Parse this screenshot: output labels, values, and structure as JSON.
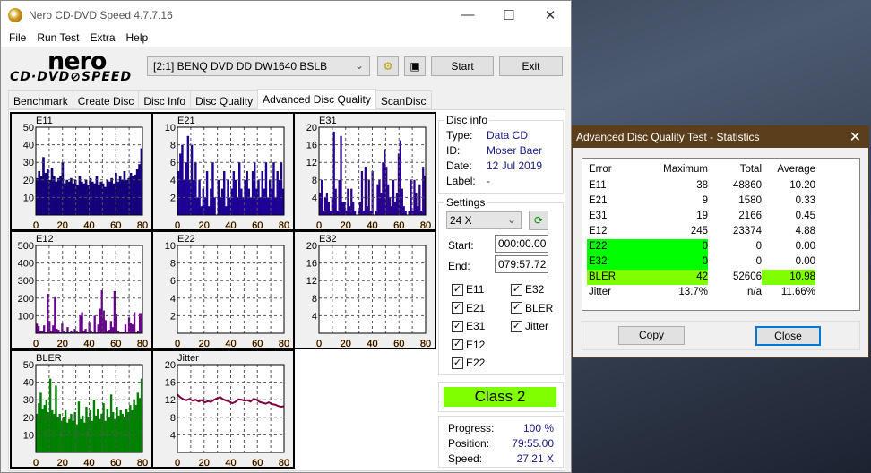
{
  "window": {
    "title": "Nero CD-DVD Speed 4.7.7.16",
    "minimize": "—",
    "maximize": "☐",
    "close": "✕"
  },
  "menu": [
    "File",
    "Run Test",
    "Extra",
    "Help"
  ],
  "logo": {
    "brand": "nero",
    "product": "CD·DVD⊘SPEED"
  },
  "toolbar": {
    "drive": "[2:1]   BENQ DVD DD DW1640 BSLB",
    "start": "Start",
    "exit": "Exit"
  },
  "tabs": [
    "Benchmark",
    "Create Disc",
    "Disc Info",
    "Disc Quality",
    "Advanced Disc Quality",
    "ScanDisc"
  ],
  "active_tab": "Advanced Disc Quality",
  "disc_info": {
    "heading": "Disc info",
    "rows": [
      {
        "k": "Type:",
        "v": "Data CD"
      },
      {
        "k": "ID:",
        "v": "Moser Baer"
      },
      {
        "k": "Date:",
        "v": "12 Jul 2019"
      },
      {
        "k": "Label:",
        "v": "-"
      }
    ]
  },
  "settings": {
    "heading": "Settings",
    "speed": "24 X",
    "start_label": "Start:",
    "start": "000:00.00",
    "end_label": "End:",
    "end": "079:57.72",
    "checks": [
      {
        "l": "E11",
        "c": true
      },
      {
        "l": "E21",
        "c": true
      },
      {
        "l": "E31",
        "c": true
      },
      {
        "l": "E12",
        "c": true
      },
      {
        "l": "E22",
        "c": true
      },
      {
        "l": "E32",
        "c": true
      },
      {
        "l": "BLER",
        "c": true
      },
      {
        "l": "Jitter",
        "c": true
      }
    ]
  },
  "class": "Class 2",
  "progress": {
    "rows": [
      {
        "k": "Progress:",
        "v": "100 %"
      },
      {
        "k": "Position:",
        "v": "79:55.00"
      },
      {
        "k": "Speed:",
        "v": "27.21 X"
      }
    ]
  },
  "chart_data": [
    {
      "name": "E11",
      "type": "bar",
      "color": "#14007a",
      "ylim": [
        0,
        50
      ],
      "yticks": [
        10,
        20,
        30,
        40,
        50
      ],
      "xlim": [
        0,
        80
      ],
      "xticks": [
        0,
        20,
        40,
        60,
        80
      ],
      "values": [
        21,
        25,
        22,
        33,
        24,
        26,
        20,
        27,
        22,
        19,
        21,
        22,
        30,
        18,
        20,
        19,
        21,
        18,
        20,
        17,
        22,
        19,
        18,
        20,
        17,
        21,
        19,
        18,
        22,
        17,
        19,
        18,
        16,
        20,
        19,
        21,
        18,
        24,
        19,
        22,
        20,
        25,
        20,
        21,
        24,
        22,
        23,
        26,
        29,
        38
      ]
    },
    {
      "name": "E21",
      "type": "bar",
      "color": "#1e0096",
      "ylim": [
        0,
        10
      ],
      "yticks": [
        2,
        4,
        6,
        8,
        10
      ],
      "xlim": [
        0,
        80
      ],
      "xticks": [
        0,
        20,
        40,
        60,
        80
      ],
      "values": [
        5,
        7,
        8,
        4,
        6,
        9,
        4,
        8,
        4,
        6,
        2,
        4,
        1,
        3,
        2,
        5,
        1,
        3,
        6,
        2,
        0,
        4,
        2,
        3,
        5,
        1,
        4,
        2,
        3,
        5,
        4,
        2,
        6,
        3,
        2,
        4,
        5,
        3,
        2,
        5,
        6,
        3,
        4,
        2,
        5,
        3,
        6,
        2,
        4,
        3,
        6,
        2,
        5,
        4,
        6,
        3
      ]
    },
    {
      "name": "E31",
      "type": "bar",
      "color": "#2a0090",
      "ylim": [
        0,
        20
      ],
      "yticks": [
        4,
        8,
        12,
        16,
        20
      ],
      "xlim": [
        0,
        80
      ],
      "xticks": [
        0,
        20,
        40,
        60,
        80
      ],
      "values": [
        5,
        8,
        1,
        4,
        5,
        3,
        1,
        4,
        19,
        6,
        1,
        8,
        18,
        3,
        3,
        1,
        6,
        2,
        6,
        3,
        1,
        0,
        1,
        3,
        10,
        1,
        11,
        2,
        8,
        1,
        10,
        0,
        1,
        7,
        8,
        5,
        12,
        15,
        11,
        7,
        4,
        2,
        8,
        3,
        5,
        14,
        17,
        6,
        2,
        1,
        0,
        1,
        8,
        1,
        8,
        5,
        2,
        7,
        1,
        11,
        9
      ]
    },
    {
      "name": "E12",
      "type": "bar",
      "color": "#6a0090",
      "ylim": [
        0,
        500
      ],
      "yticks": [
        100,
        200,
        300,
        400,
        500
      ],
      "xlim": [
        0,
        80
      ],
      "xticks": [
        0,
        20,
        40,
        60,
        80
      ],
      "values": [
        55,
        40,
        15,
        10,
        45,
        5,
        225,
        70,
        10,
        45,
        210,
        25,
        20,
        5,
        55,
        10,
        5,
        35,
        5,
        10,
        5,
        25,
        10,
        5,
        100,
        120,
        10,
        25,
        5,
        65,
        10,
        5,
        100,
        5,
        50,
        140,
        245,
        130,
        75,
        10,
        20,
        70,
        35,
        240,
        110,
        10,
        5,
        5,
        5,
        50,
        5,
        90,
        60,
        50,
        120,
        5,
        10,
        115,
        115
      ]
    },
    {
      "name": "E22",
      "type": "bar",
      "color": "#000080",
      "ylim": [
        0,
        10
      ],
      "yticks": [
        2,
        4,
        6,
        8,
        10
      ],
      "xlim": [
        0,
        80
      ],
      "xticks": [
        0,
        20,
        40,
        60,
        80
      ],
      "values": []
    },
    {
      "name": "E32",
      "type": "bar",
      "color": "#000080",
      "ylim": [
        0,
        20
      ],
      "yticks": [
        4,
        8,
        12,
        16,
        20
      ],
      "xlim": [
        0,
        80
      ],
      "xticks": [
        0,
        20,
        40,
        60,
        80
      ],
      "values": []
    },
    {
      "name": "BLER",
      "type": "bar",
      "color": "#008000",
      "ylim": [
        0,
        50
      ],
      "yticks": [
        10,
        20,
        30,
        40,
        50
      ],
      "xlim": [
        0,
        80
      ],
      "xticks": [
        0,
        20,
        40,
        60,
        80
      ],
      "values": [
        22,
        28,
        34,
        25,
        27,
        30,
        23,
        42,
        24,
        22,
        38,
        20,
        22,
        18,
        20,
        24,
        17,
        19,
        22,
        18,
        23,
        16,
        29,
        19,
        21,
        17,
        26,
        20,
        24,
        18,
        30,
        21,
        25,
        19,
        22,
        28,
        18,
        25,
        20,
        33,
        23,
        19,
        26,
        21,
        24,
        22,
        20,
        25,
        23,
        27,
        24,
        30,
        27,
        34,
        31,
        42
      ]
    },
    {
      "name": "Jitter",
      "type": "line",
      "color": "#800040",
      "ylim": [
        0,
        20
      ],
      "yticks": [
        4,
        8,
        12,
        16,
        20
      ],
      "xlim": [
        0,
        80
      ],
      "xticks": [
        0,
        20,
        40,
        60,
        80
      ],
      "values": [
        13.2,
        12.5,
        12.1,
        11.9,
        12.2,
        11.8,
        12.0,
        11.6,
        11.9,
        11.4,
        11.7,
        11.5,
        12.0,
        12.3,
        12.6,
        12.1,
        11.8,
        11.6,
        11.2,
        11.5,
        12.1,
        12.0,
        11.8,
        11.9,
        11.6,
        12.2,
        12.0,
        11.5,
        11.3,
        11.1,
        11.4,
        11.0,
        10.9,
        10.6,
        10.4,
        10.5
      ]
    }
  ],
  "stats": {
    "title": "Advanced Disc Quality Test - Statistics",
    "close": "✕",
    "headers": [
      "Error",
      "Maximum",
      "Total",
      "Average"
    ],
    "rows": [
      [
        "E11",
        "38",
        "48860",
        "10.20"
      ],
      [
        "E21",
        "9",
        "1580",
        "0.33"
      ],
      [
        "E31",
        "19",
        "2166",
        "0.45"
      ],
      [
        "E12",
        "245",
        "23374",
        "4.88"
      ],
      [
        "E22",
        "0",
        "0",
        "0.00"
      ],
      [
        "E32",
        "0",
        "0",
        "0.00"
      ],
      [
        "BLER",
        "42",
        "52606",
        "10.98"
      ],
      [
        "Jitter",
        "13.7%",
        "n/a",
        "11.66%"
      ]
    ],
    "highlight_green": "#00ff00",
    "highlight_lime": "#80ff00",
    "copy": "Copy",
    "close_btn": "Close"
  }
}
